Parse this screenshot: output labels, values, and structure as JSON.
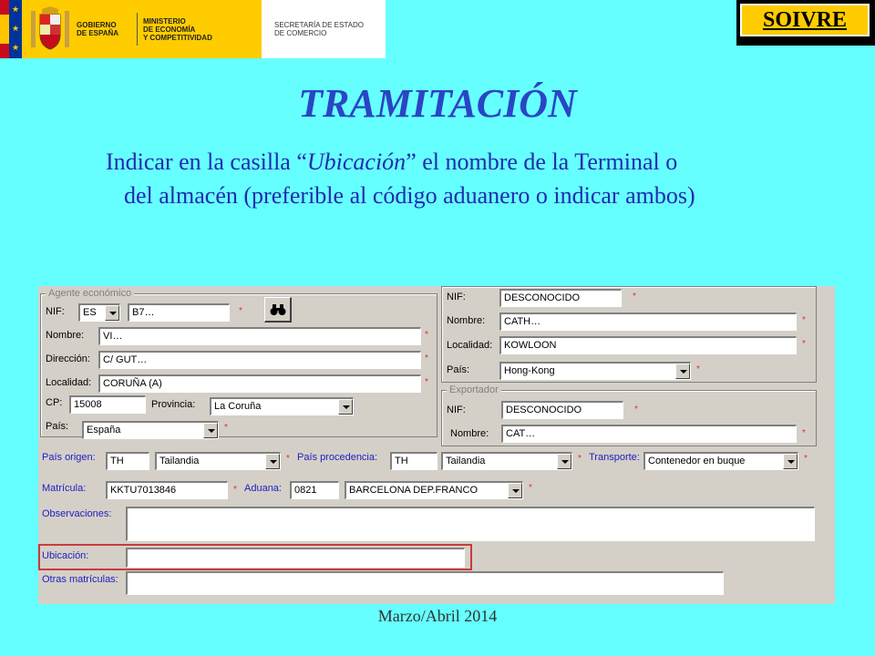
{
  "header": {
    "gobierno": [
      "GOBIERNO",
      "DE ESPAÑA"
    ],
    "ministerio": [
      "MINISTERIO",
      "DE ECONOMÍA",
      "Y COMPETITIVIDAD"
    ],
    "secretaria": [
      "SECRETARÍA DE ESTADO",
      "DE COMERCIO"
    ],
    "badge": "SOIVRE"
  },
  "slide": {
    "title": "TRAMITACIÓN",
    "instr_prefix": "Indicar en la casilla “",
    "instr_italic": "Ubicación",
    "instr_suffix": "” el nombre de la Terminal o",
    "instr_line2": "del almacén (preferible al código aduanero o indicar ambos)",
    "footer": "Marzo/Abril 2014"
  },
  "form": {
    "agente_legend": "Agente económico",
    "nif_label": "NIF:",
    "nif_country": "ES",
    "nif_value": "B7…",
    "nombre_label": "Nombre:",
    "nombre_value": "VI…",
    "direccion_label": "Dirección:",
    "direccion_value": "C/ GUT…",
    "localidad_label": "Localidad:",
    "localidad_value": "CORUÑA (A)",
    "cp_label": "CP:",
    "cp_value": "15008",
    "provincia_label": "Provincia:",
    "provincia_value": "La Coruña",
    "pais_label": "País:",
    "pais_value": "España",
    "dest_nif_label": "NIF:",
    "dest_nif_value": "DESCONOCIDO",
    "dest_nombre_label": "Nombre:",
    "dest_nombre_value": "CATH…",
    "dest_localidad_label": "Localidad:",
    "dest_localidad_value": "KOWLOON",
    "dest_pais_label": "País:",
    "dest_pais_value": "Hong-Kong",
    "exportador_legend": "Exportador",
    "exp_nif_label": "NIF:",
    "exp_nif_value": "DESCONOCIDO",
    "exp_nombre_label": "Nombre:",
    "exp_nombre_value": "CAT…",
    "pais_origen_label": "País origen:",
    "pais_origen_code": "TH",
    "pais_origen_value": "Tailandia",
    "pais_proc_label": "País procedencia:",
    "pais_proc_code": "TH",
    "pais_proc_value": "Tailandia",
    "transporte_label": "Transporte:",
    "transporte_value": "Contenedor en buque",
    "matricula_label": "Matrícula:",
    "matricula_value": "KKTU7013846",
    "aduana_label": "Aduana:",
    "aduana_code": "0821",
    "aduana_value": "BARCELONA DEP.FRANCO",
    "observaciones_label": "Observaciones:",
    "observaciones_value": "",
    "ubicacion_label": "Ubicación:",
    "ubicacion_value": "",
    "otras_label": "Otras matrículas:",
    "otras_value": "",
    "required_mark": "*"
  },
  "colors": {
    "background": "#66FFFF",
    "title": "#2a45c4",
    "text": "#1f2bb0",
    "highlight": "#c83c3c",
    "soivre_badge": "#ffcc00"
  }
}
